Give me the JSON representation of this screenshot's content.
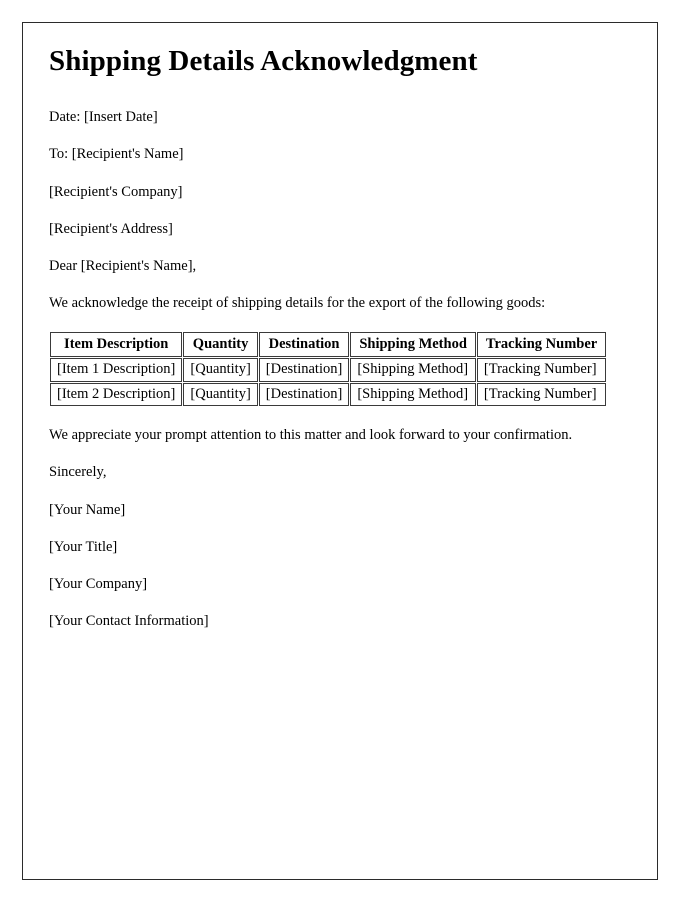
{
  "document": {
    "title": "Shipping Details Acknowledgment",
    "date_line": "Date: [Insert Date]",
    "to_line": "To: [Recipient's Name]",
    "recipient_company": "[Recipient's Company]",
    "recipient_address": "[Recipient's Address]",
    "salutation": "Dear [Recipient's Name],",
    "intro_paragraph": "We acknowledge the receipt of shipping details for the export of the following goods:",
    "closing_paragraph": "We appreciate your prompt attention to this matter and look forward to your confirmation.",
    "sign_off": "Sincerely,",
    "signature": {
      "name": "[Your Name]",
      "title": "[Your Title]",
      "company": "[Your Company]",
      "contact": "[Your Contact Information]"
    }
  },
  "table": {
    "headers": [
      "Item Description",
      "Quantity",
      "Destination",
      "Shipping Method",
      "Tracking Number"
    ],
    "rows": [
      {
        "item_description": "[Item 1 Description]",
        "quantity": "[Quantity]",
        "destination": "[Destination]",
        "shipping_method": "[Shipping Method]",
        "tracking_number": "[Tracking Number]"
      },
      {
        "item_description": "[Item 2 Description]",
        "quantity": "[Quantity]",
        "destination": "[Destination]",
        "shipping_method": "[Shipping Method]",
        "tracking_number": "[Tracking Number]"
      }
    ]
  },
  "style": {
    "page_border_color": "#2b2b2b",
    "table_border_color": "#3a3a3a",
    "text_color": "#000000",
    "page_background": "#ffffff"
  }
}
